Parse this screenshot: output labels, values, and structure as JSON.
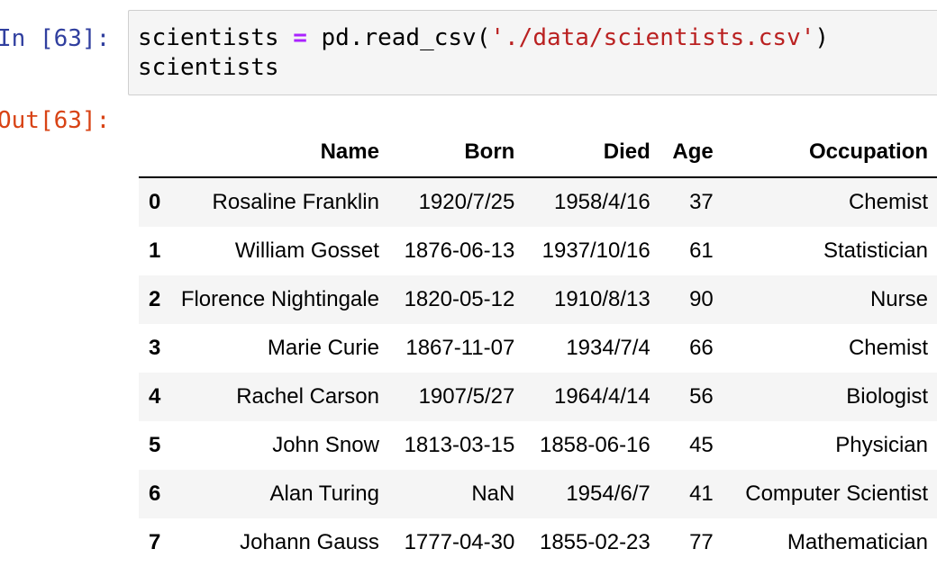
{
  "cell": {
    "in_prompt": "In [63]:",
    "out_prompt": "Out[63]:",
    "code": {
      "line1": {
        "var": "scientists",
        "op": "=",
        "call": "pd.read_csv(",
        "arg": "'./data/scientists.csv'",
        "close": ")"
      },
      "line2": "scientists"
    }
  },
  "table": {
    "columns": [
      "Name",
      "Born",
      "Died",
      "Age",
      "Occupation"
    ],
    "rows": [
      {
        "index": "0",
        "name": "Rosaline Franklin",
        "born": "1920/7/25",
        "died": "1958/4/16",
        "age": "37",
        "occupation": "Chemist"
      },
      {
        "index": "1",
        "name": "William Gosset",
        "born": "1876-06-13",
        "died": "1937/10/16",
        "age": "61",
        "occupation": "Statistician"
      },
      {
        "index": "2",
        "name": "Florence Nightingale",
        "born": "1820-05-12",
        "died": "1910/8/13",
        "age": "90",
        "occupation": "Nurse"
      },
      {
        "index": "3",
        "name": "Marie Curie",
        "born": "1867-11-07",
        "died": "1934/7/4",
        "age": "66",
        "occupation": "Chemist"
      },
      {
        "index": "4",
        "name": "Rachel Carson",
        "born": "1907/5/27",
        "died": "1964/4/14",
        "age": "56",
        "occupation": "Biologist"
      },
      {
        "index": "5",
        "name": "John Snow",
        "born": "1813-03-15",
        "died": "1858-06-16",
        "age": "45",
        "occupation": "Physician"
      },
      {
        "index": "6",
        "name": "Alan Turing",
        "born": "NaN",
        "died": "1954/6/7",
        "age": "41",
        "occupation": "Computer Scientist"
      },
      {
        "index": "7",
        "name": "Johann Gauss",
        "born": "1777-04-30",
        "died": "1855-02-23",
        "age": "77",
        "occupation": "Mathematician"
      }
    ]
  }
}
